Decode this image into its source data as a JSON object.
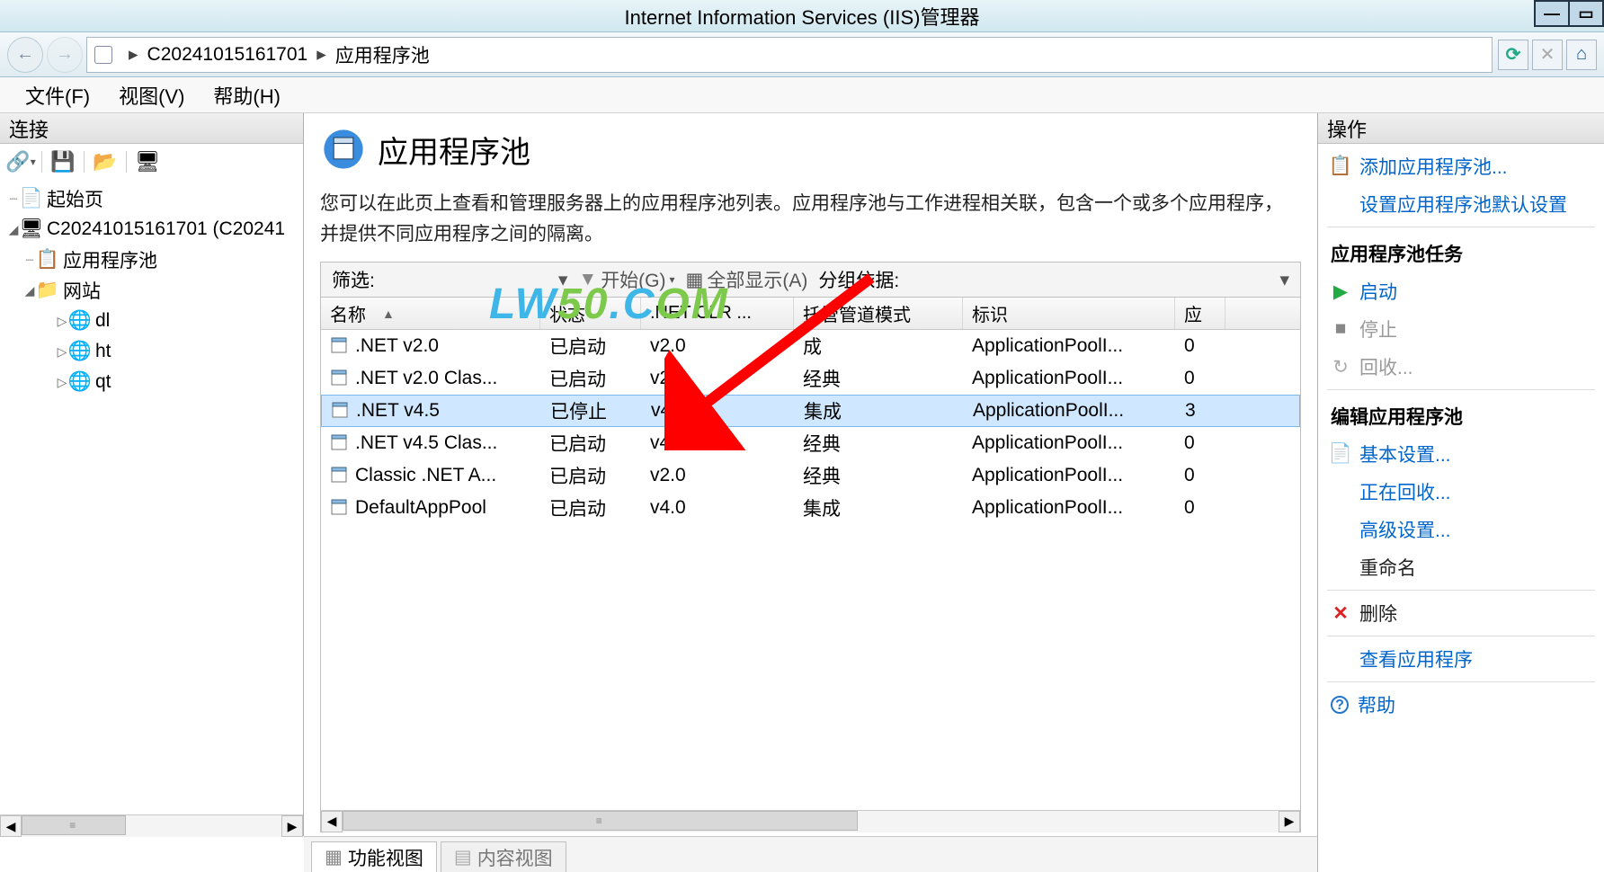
{
  "window": {
    "title": "Internet Information Services (IIS)管理器"
  },
  "breadcrumb": {
    "server": "C20241015161701",
    "node": "应用程序池"
  },
  "menus": {
    "file": "文件(F)",
    "view": "视图(V)",
    "help": "帮助(H)"
  },
  "left": {
    "header": "连接",
    "start_page": "起始页",
    "server_node": "C20241015161701 (C20241",
    "app_pools": "应用程序池",
    "sites": "网站",
    "site_items": [
      "dl",
      "ht",
      "qt"
    ]
  },
  "center": {
    "title": "应用程序池",
    "desc": "您可以在此页上查看和管理服务器上的应用程序池列表。应用程序池与工作进程相关联，包含一个或多个应用程序，并提供不同应用程序之间的隔离。",
    "filter_label": "筛选:",
    "start_btn": "开始(G)",
    "show_all_btn": "全部显示(A)",
    "group_label": "分组依据:",
    "columns": {
      "name": "名称",
      "state": "状态",
      "clr": ".NET CLR ...",
      "pipe": "托管管道模式",
      "id": "标识",
      "apps": "应"
    },
    "rows": [
      {
        "name": ".NET v2.0",
        "state": "已启动",
        "clr": "v2.0",
        "pipe": "成",
        "id": "ApplicationPoolI...",
        "apps": "0",
        "selected": false
      },
      {
        "name": ".NET v2.0 Clas...",
        "state": "已启动",
        "clr": "v2.0",
        "pipe": "经典",
        "id": "ApplicationPoolI...",
        "apps": "0",
        "selected": false
      },
      {
        "name": ".NET v4.5",
        "state": "已停止",
        "clr": "v4.0",
        "pipe": "集成",
        "id": "ApplicationPoolI...",
        "apps": "3",
        "selected": true
      },
      {
        "name": ".NET v4.5 Clas...",
        "state": "已启动",
        "clr": "v4.0",
        "pipe": "经典",
        "id": "ApplicationPoolI...",
        "apps": "0",
        "selected": false
      },
      {
        "name": "Classic .NET A...",
        "state": "已启动",
        "clr": "v2.0",
        "pipe": "经典",
        "id": "ApplicationPoolI...",
        "apps": "0",
        "selected": false
      },
      {
        "name": "DefaultAppPool",
        "state": "已启动",
        "clr": "v4.0",
        "pipe": "集成",
        "id": "ApplicationPoolI...",
        "apps": "0",
        "selected": false
      }
    ],
    "tabs": {
      "features": "功能视图",
      "content": "内容视图"
    }
  },
  "right": {
    "header": "操作",
    "add": "添加应用程序池...",
    "defaults": "设置应用程序池默认设置",
    "tasks_heading": "应用程序池任务",
    "start": "启动",
    "stop": "停止",
    "recycle": "回收...",
    "edit_heading": "编辑应用程序池",
    "basic": "基本设置...",
    "recycling": "正在回收...",
    "advanced": "高级设置...",
    "rename": "重命名",
    "delete": "删除",
    "view_apps": "查看应用程序",
    "help": "帮助"
  },
  "watermark": "LW50.COM"
}
